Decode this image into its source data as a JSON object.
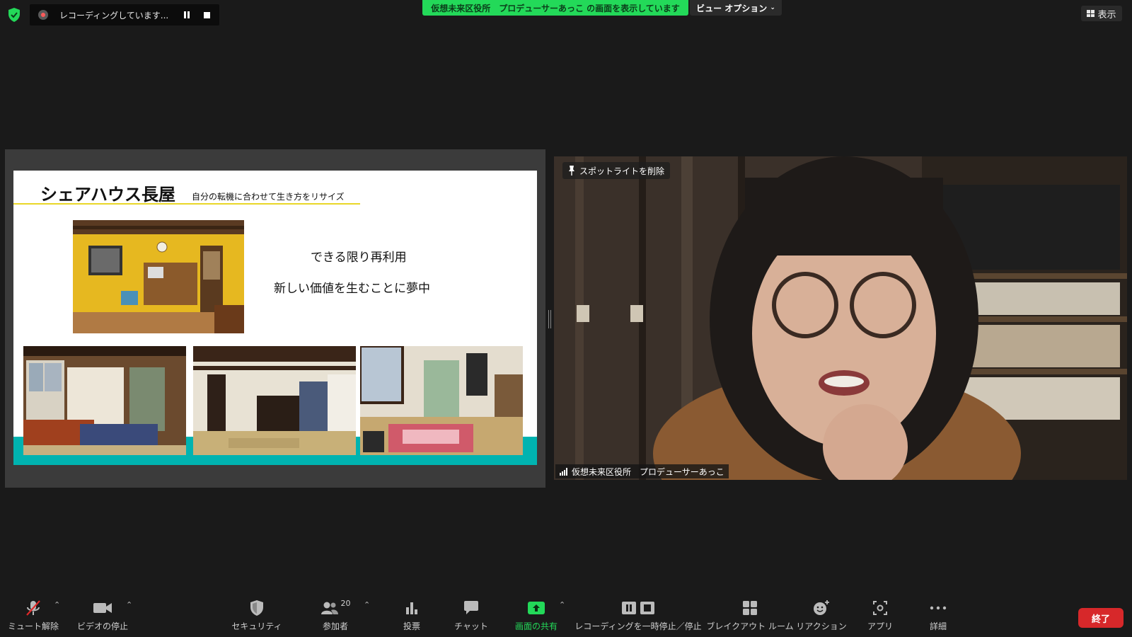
{
  "top_bar": {
    "recording_status": "レコーディングしています...",
    "share_banner": "仮想未来区役所　プロデューサーあっこ の画面を表示しています",
    "view_options": "ビュー オプション",
    "view_button": "表示"
  },
  "slide": {
    "title": "シェアハウス長屋",
    "subtitle": "自分の転機に合わせて生き方をリサイズ",
    "line1": "できる限り再利用",
    "line2": "新しい価値を生むことに夢中"
  },
  "video": {
    "remove_spotlight": "スポットライトを削除",
    "participant_name": "仮想未来区役所　プロデューサーあっこ"
  },
  "toolbar": {
    "unmute": "ミュート解除",
    "stop_video": "ビデオの停止",
    "security": "セキュリティ",
    "participants": "参加者",
    "participant_count": "20",
    "polls": "投票",
    "chat": "チャット",
    "share_screen": "画面の共有",
    "pause_recording": "レコーディングを一時停止／停止",
    "breakout": "ブレイクアウト ルーム",
    "reactions": "リアクション",
    "apps": "アプリ",
    "more": "詳細",
    "end": "終了"
  },
  "colors": {
    "share_green": "#23d959",
    "end_red": "#d7282a",
    "slide_teal": "#00b3b0",
    "title_rule_yellow": "#e9d728"
  }
}
